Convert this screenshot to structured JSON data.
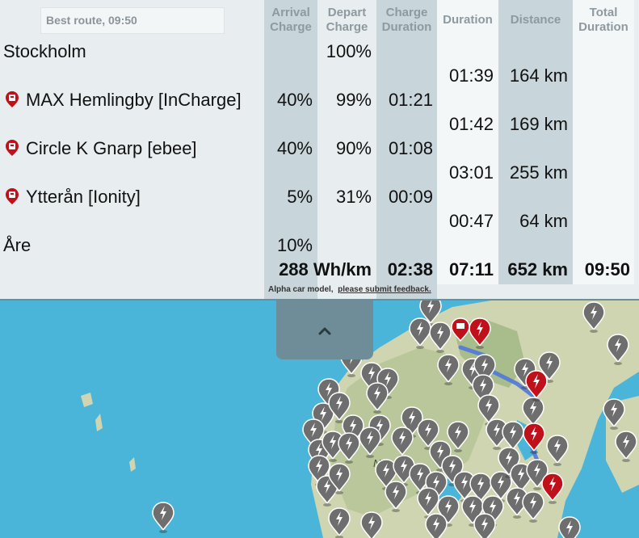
{
  "header": {
    "title": "Best route, 09:50"
  },
  "columns": {
    "arrival_charge": [
      "Arrival",
      "Charge"
    ],
    "depart_charge": [
      "Depart",
      "Charge"
    ],
    "charge_duration": [
      "Charge",
      "Duration"
    ],
    "duration": "Duration",
    "distance": "Distance",
    "total_duration": [
      "Total",
      "Duration"
    ]
  },
  "stops": [
    {
      "name": "Stockholm",
      "charger_icon": false,
      "arrival": "",
      "depart": "100%",
      "charge_time": ""
    },
    {
      "name": "MAX Hemlingby [InCharge]",
      "charger_icon": true,
      "arrival": "40%",
      "depart": "99%",
      "charge_time": "01:21"
    },
    {
      "name": "Circle K Gnarp [ebee]",
      "charger_icon": true,
      "arrival": "40%",
      "depart": "90%",
      "charge_time": "01:08"
    },
    {
      "name": "Ytterån [Ionity]",
      "charger_icon": true,
      "arrival": "5%",
      "depart": "31%",
      "charge_time": "00:09"
    },
    {
      "name": "Åre",
      "charger_icon": false,
      "arrival": "10%",
      "depart": "",
      "charge_time": ""
    }
  ],
  "legs": [
    {
      "duration": "01:39",
      "distance": "164 km"
    },
    {
      "duration": "01:42",
      "distance": "169 km"
    },
    {
      "duration": "03:01",
      "distance": "255 km"
    },
    {
      "duration": "00:47",
      "distance": "64 km"
    }
  ],
  "totals": {
    "consumption": "288 Wh/km",
    "charge_time": "02:38",
    "driving_time": "07:11",
    "distance": "652 km",
    "total_duration": "09:50"
  },
  "footer": {
    "note": "Alpha car model,",
    "feedback_link": "please submit feedback."
  },
  "map": {
    "label": "Norge"
  },
  "colors": {
    "panel_bg": "#e8edf0",
    "column_shade": "#c8d5da",
    "accent": "#6f8d99",
    "sea": "#4ab5d8",
    "land": "#cfd5b0",
    "route": "#4f78d8",
    "pin_gray": "#6e6e6e",
    "pin_red": "#c0101a"
  },
  "icons": {
    "charger": "charger-pin-icon",
    "collapse": "chevron-up-icon"
  }
}
